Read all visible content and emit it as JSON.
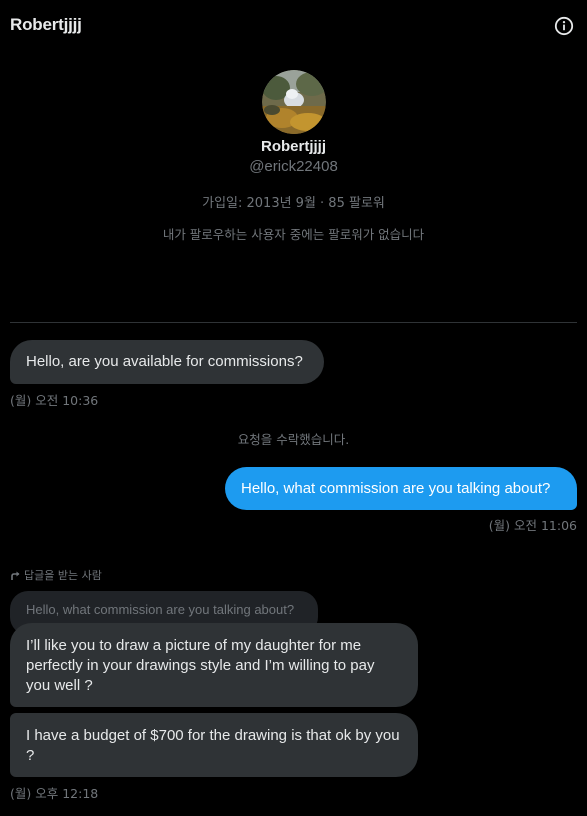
{
  "header": {
    "title": "Robertjjjj",
    "info_icon": "info-circle-icon"
  },
  "profile": {
    "avatar_icon": "avatar-photo",
    "name": "Robertjjjj",
    "handle": "@erick22408",
    "meta": "가입일: 2013년 9월 · 85 팔로워",
    "followers_note": "내가 팔로우하는 사용자 중에는 팔로워가 없습니다"
  },
  "messages": {
    "m1": {
      "text": "Hello, are you available for commissions?",
      "time": "(월) 오전 10:36"
    },
    "system": "요청을 수락했습니다.",
    "m2": {
      "text": "Hello, what commission are you talking about?",
      "time": "(월) 오전 11:06"
    },
    "reply_label": "답글을 받는 사람",
    "quoted": "Hello, what commission are you talking about?",
    "m3": {
      "text": "I’ll like you to draw a picture of my daughter for me perfectly in your drawings style and I’m willing to pay you well ?"
    },
    "m4": {
      "text": "I have a budget of $700 for the drawing is that ok by you ?",
      "time": "(월) 오후 12:18"
    }
  },
  "colors": {
    "background": "#000000",
    "incoming_bubble": "#2f3336",
    "outgoing_bubble": "#1d9bf0",
    "muted_text": "#71767b"
  }
}
